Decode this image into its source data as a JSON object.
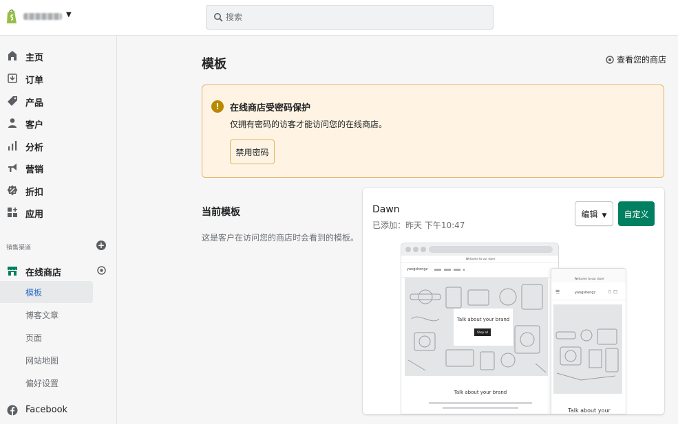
{
  "topbar": {
    "search_placeholder": "搜索"
  },
  "sidebar": {
    "items": [
      {
        "label": "主页",
        "icon": "home-icon"
      },
      {
        "label": "订单",
        "icon": "orders-icon"
      },
      {
        "label": "产品",
        "icon": "tag-icon"
      },
      {
        "label": "客户",
        "icon": "person-icon"
      },
      {
        "label": "分析",
        "icon": "bar-chart-icon"
      },
      {
        "label": "营销",
        "icon": "megaphone-icon"
      },
      {
        "label": "折扣",
        "icon": "discount-icon"
      },
      {
        "label": "应用",
        "icon": "apps-icon"
      }
    ],
    "sales_channels_title": "销售渠道",
    "online_store": "在线商店",
    "sub_items": [
      "模板",
      "博客文章",
      "页面",
      "网站地图",
      "偏好设置"
    ],
    "facebook": "Facebook"
  },
  "main": {
    "title": "模板",
    "view_store": "查看您的商店",
    "banner": {
      "title": "在线商店受密码保护",
      "body": "仅拥有密码的访客才能访问您的在线商店。",
      "button": "禁用密码"
    },
    "current": {
      "title": "当前模板",
      "desc": "这是客户在访问您的商店时会看到的模板。"
    },
    "theme": {
      "name": "Dawn",
      "added": "已添加：昨天 下午10:47",
      "edit_button": "编辑",
      "customize_button": "自定义",
      "preview": {
        "announcement": "Welcome to our store",
        "brand": "yangshengz",
        "hero_text": "Talk about your brand",
        "hero_button": "Shop all",
        "section_title": "Talk about your brand",
        "mobile_section_title": "Talk about your"
      }
    }
  },
  "colors": {
    "primary": "#008060",
    "banner_bg": "#fff4e4",
    "banner_border": "#e0b366",
    "warning_icon": "#b98900",
    "logo": "#95bf47",
    "active_link": "#2c6ecb"
  }
}
